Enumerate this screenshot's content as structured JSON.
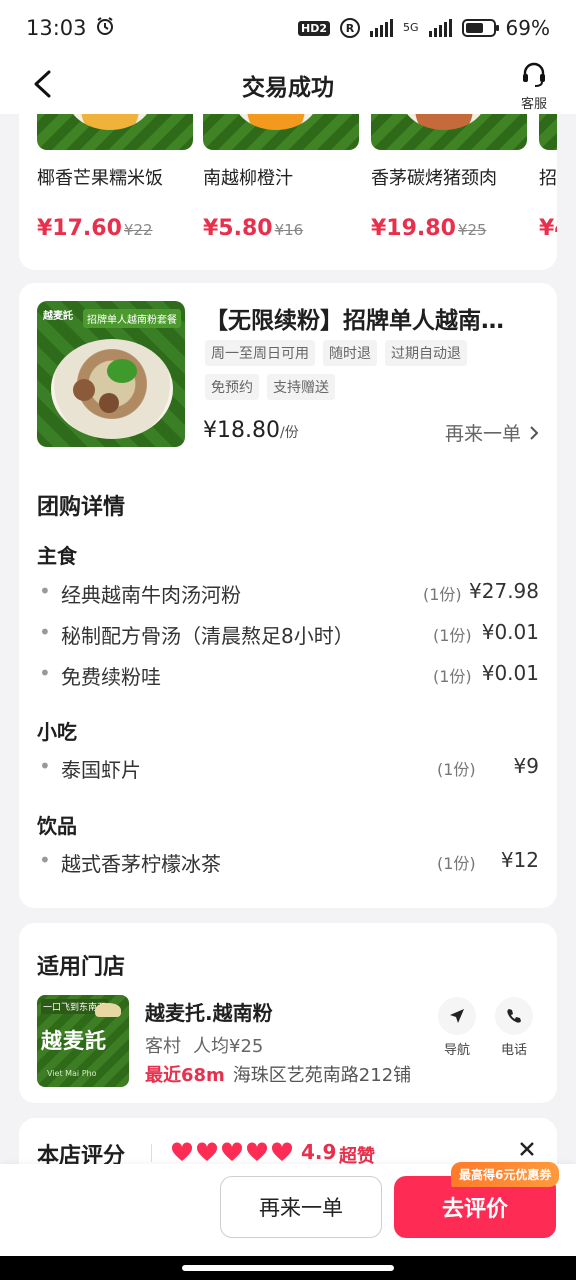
{
  "status_bar": {
    "time": "13:03",
    "hd_badge": "HD2",
    "r_icon_text": "R",
    "network": "5G",
    "battery": "69%",
    "battery_level": 0.69
  },
  "nav": {
    "title": "交易成功",
    "service_label": "客服"
  },
  "recommendations": [
    {
      "name": "椰香芒果糯米饭",
      "price": "¥17.60",
      "original_price": "¥22",
      "dish_color": "#f0b23a"
    },
    {
      "name": "南越柳橙汁",
      "price": "¥5.80",
      "original_price": "¥16",
      "dish_color": "#f39a1e"
    },
    {
      "name": "香茅碳烤猪颈肉",
      "price": "¥19.80",
      "original_price": "¥25",
      "dish_color": "#c56a3a"
    },
    {
      "name": "招",
      "price": "¥4",
      "original_price": "",
      "dish_color": "#d98a3a"
    }
  ],
  "deal": {
    "title": "【无限续粉】招牌单人越南…",
    "image_banner": "招牌单人越南粉套餐",
    "image_brand": "越麦託",
    "tags": [
      "周一至周日可用",
      "随时退",
      "过期自动退",
      "免预约",
      "支持赠送"
    ],
    "price": "¥18.80",
    "price_unit": "/份",
    "reorder_label": "再来一单"
  },
  "details": {
    "heading": "团购详情",
    "groups": [
      {
        "title": "主食",
        "items": [
          {
            "name": "经典越南牛肉汤河粉",
            "qty": "(1份)",
            "price": "¥27.98"
          },
          {
            "name": "秘制配方骨汤（清晨熬足8小时）",
            "qty": "(1份)",
            "price": "¥0.01"
          },
          {
            "name": "免费续粉哇",
            "qty": "(1份)",
            "price": "¥0.01"
          }
        ]
      },
      {
        "title": "小吃",
        "items": [
          {
            "name": "泰国虾片",
            "qty": "(1份)",
            "price": "¥9"
          }
        ]
      },
      {
        "title": "饮品",
        "items": [
          {
            "name": "越式香茅柠檬冰茶",
            "qty": "(1份)",
            "price": "¥12"
          }
        ]
      }
    ]
  },
  "store": {
    "heading": "适用门店",
    "name": "越麦托.越南粉",
    "area": "客村",
    "avg_price": "人均¥25",
    "distance": "最近68m",
    "address": "海珠区艺苑南路212铺",
    "navigate_label": "导航",
    "phone_label": "电话",
    "logo_tag": "一口飞到东南亚",
    "logo_text": "越麦託",
    "logo_sub": "Viet Mai Pho"
  },
  "rating": {
    "label": "本店评分",
    "score": "4.9",
    "text": "超赞",
    "hearts": 5
  },
  "bottom": {
    "reorder_label": "再来一单",
    "review_label": "去评价",
    "promo_badge": "最高得6元优惠券"
  },
  "colors": {
    "accent": "#fe2c55",
    "price_red": "#e8304d",
    "promo_orange": "#ff7a2a"
  }
}
